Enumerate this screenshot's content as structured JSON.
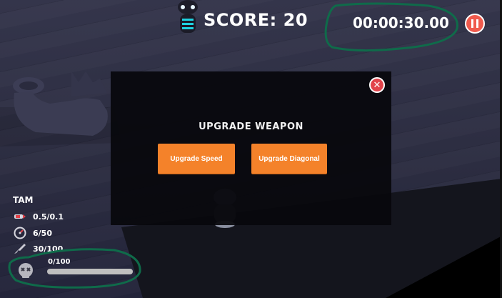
{
  "hud": {
    "score_text": "SCORE: 20",
    "timer": "00:00:30.00",
    "pause_icon": "pause-icon"
  },
  "dialog": {
    "title": "UPGRADE WEAPON",
    "close_icon": "close-icon",
    "buttons": {
      "speed": "Upgrade Speed",
      "diagonal": "Upgrade Diagonal"
    }
  },
  "player": {
    "name": "TAM",
    "stats": {
      "fire_rate": "0.5/0.1",
      "speed": "6/50",
      "ammo": "30/100"
    },
    "health": {
      "text": "0/100",
      "fraction": 0.0
    }
  },
  "colors": {
    "button": "#f4822a",
    "close": "#e2434b",
    "pause": "#f05a4d",
    "annotation": "#0f6b4a"
  }
}
